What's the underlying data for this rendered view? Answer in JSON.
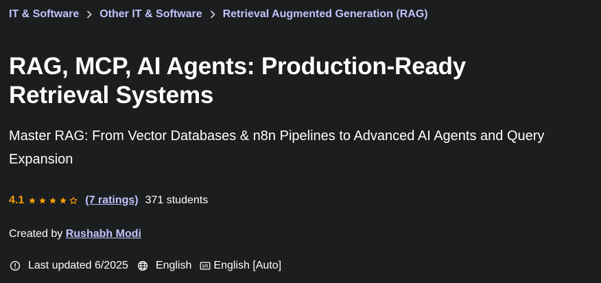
{
  "breadcrumb": {
    "items": [
      {
        "label": "IT & Software"
      },
      {
        "label": "Other IT & Software"
      },
      {
        "label": "Retrieval Augmented Generation (RAG)"
      }
    ]
  },
  "course": {
    "title": "RAG, MCP, AI Agents: Production-Ready Retrieval Systems",
    "subtitle": "Master RAG: From Vector Databases & n8n Pipelines to Advanced AI Agents and Query Expansion",
    "rating": {
      "value": "4.1",
      "stars": 4.1,
      "ratings_text": "(7 ratings)",
      "students_text": "371 students"
    },
    "created_by_label": "Created by",
    "author": "Rushabh Modi",
    "last_updated": "Last updated 6/2025",
    "language": "English",
    "captions": "English [Auto]"
  },
  "colors": {
    "background": "#1c1d1f",
    "link": "#c0c4fc",
    "rating": "#f69c08",
    "text": "#ffffff"
  },
  "icons": {
    "breadcrumb_separator": "chevron-right-icon",
    "last_updated": "alert-circle-icon",
    "language": "globe-icon",
    "captions": "closed-captions-icon",
    "rating_star": "star-icon"
  }
}
